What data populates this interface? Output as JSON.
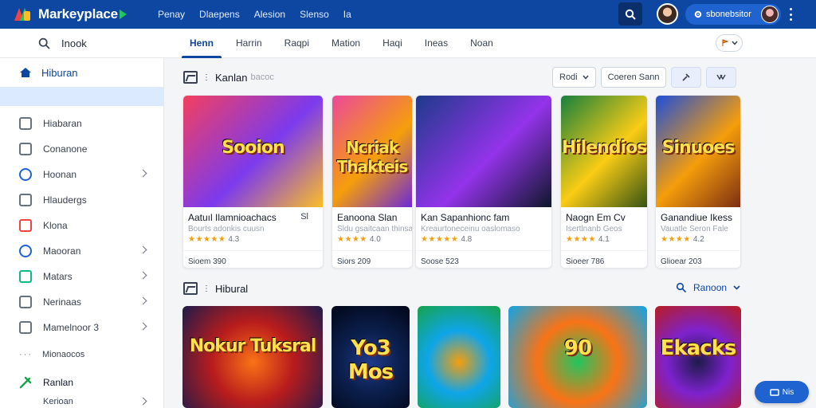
{
  "brand": {
    "name": "Markeyplace"
  },
  "topnav": [
    "Penay",
    "Dlaepens",
    "Alesion",
    "Slenso",
    "Ia"
  ],
  "user": {
    "name": "sbonebsitor"
  },
  "subbar": {
    "search_label": "Inook",
    "tabs": [
      "Henn",
      "Harrin",
      "Raqpi",
      "Mation",
      "Haqi",
      "Ineas",
      "Noan"
    ]
  },
  "sidebar": {
    "header": "Hiburan",
    "items": [
      {
        "label": "Hiabaran",
        "icon": "home-icon",
        "color": "#6b7280",
        "chevron": false
      },
      {
        "label": "Conanone",
        "icon": "camera-icon",
        "color": "#6b7280",
        "chevron": false
      },
      {
        "label": "Hoonan",
        "icon": "globe-icon",
        "color": "#1e63d0",
        "chevron": true
      },
      {
        "label": "Hlaudergs",
        "icon": "chat-icon",
        "color": "#6b7280",
        "chevron": false
      },
      {
        "label": "Klona",
        "icon": "tv-icon",
        "color": "#ef4444",
        "chevron": false
      },
      {
        "label": "Maooran",
        "icon": "compass-icon",
        "color": "#1e63d0",
        "chevron": true
      },
      {
        "label": "Matars",
        "icon": "puzzle-icon",
        "color": "#10b981",
        "chevron": true
      },
      {
        "label": "Nerinaas",
        "icon": "tag-icon",
        "color": "#6b7280",
        "chevron": true
      },
      {
        "label": "Mamelnoor 3",
        "icon": "calendar-icon",
        "color": "#6b7280",
        "chevron": true
      }
    ],
    "more": "Mionaocos",
    "footer": {
      "label": "Ranlan",
      "sub": "Kerioan"
    }
  },
  "section1": {
    "title": "Kanlan",
    "subtitle": "bacoc",
    "filters": {
      "sort": "Rodi",
      "search": "Coeren Sann"
    },
    "cards": [
      {
        "title": "Aatuıl Ilamnioachacs",
        "meta": "Sl",
        "sub": "Bourts adonkis cuusn",
        "rating": "4.3",
        "stars": "★★★★★",
        "price": "Sioem 390",
        "art": "Sooion",
        "colors": [
          "#f43f5e",
          "#7c3aed",
          "#fbbf24"
        ]
      },
      {
        "title": "Eanoona Slan",
        "sub": "Sldu gsaitcaan thinsa",
        "rating": "4.0",
        "stars": "★★★★",
        "price": "Siors 209",
        "art": "Ncriak Thakteis",
        "colors": [
          "#ec4899",
          "#f59e0b",
          "#6d28d9"
        ]
      },
      {
        "title": "Kan Sapanhionc fam",
        "sub": "Kreaurtoneceinu oaslomaso",
        "rating": "4.8",
        "stars": "★★★★★",
        "price": "Soose 523",
        "art": "",
        "colors": [
          "#1e3a8a",
          "#9333ea",
          "#0f172a"
        ]
      },
      {
        "title": "Naogn Em Cv",
        "sub": "Isertlnanb Geos",
        "rating": "4.1",
        "stars": "★★★★",
        "price": "Sioeer 786",
        "art": "Hilendios",
        "colors": [
          "#15803d",
          "#facc15",
          "#365314"
        ]
      },
      {
        "title": "Ganandiue Ikess",
        "sub": "Vauatle Seron Fale",
        "rating": "4.2",
        "stars": "★★★★",
        "price": "Glioear 203",
        "art": "Sinuoes",
        "colors": [
          "#1d4ed8",
          "#f59e0b",
          "#7c2d12"
        ]
      }
    ]
  },
  "section2": {
    "title": "Hibural",
    "sort_label": "Ranoon",
    "thumbs": [
      {
        "art": "Nokur Tuksral",
        "colors": [
          "#b91c1c",
          "#f97316",
          "#1e1b4b"
        ]
      },
      {
        "art": "Yo3 Mos",
        "colors": [
          "#0b1f4d",
          "#1e3a8a",
          "#020617"
        ]
      },
      {
        "art": "",
        "colors": [
          "#0ea5e9",
          "#f59e0b",
          "#16a34a"
        ]
      },
      {
        "art": "90",
        "colors": [
          "#f97316",
          "#22c55e",
          "#0ea5e9"
        ]
      },
      {
        "art": "Ekacks",
        "colors": [
          "#7e22ce",
          "#1e1b4b",
          "#b91c1c"
        ]
      }
    ]
  },
  "fab": {
    "label": "Nis"
  }
}
